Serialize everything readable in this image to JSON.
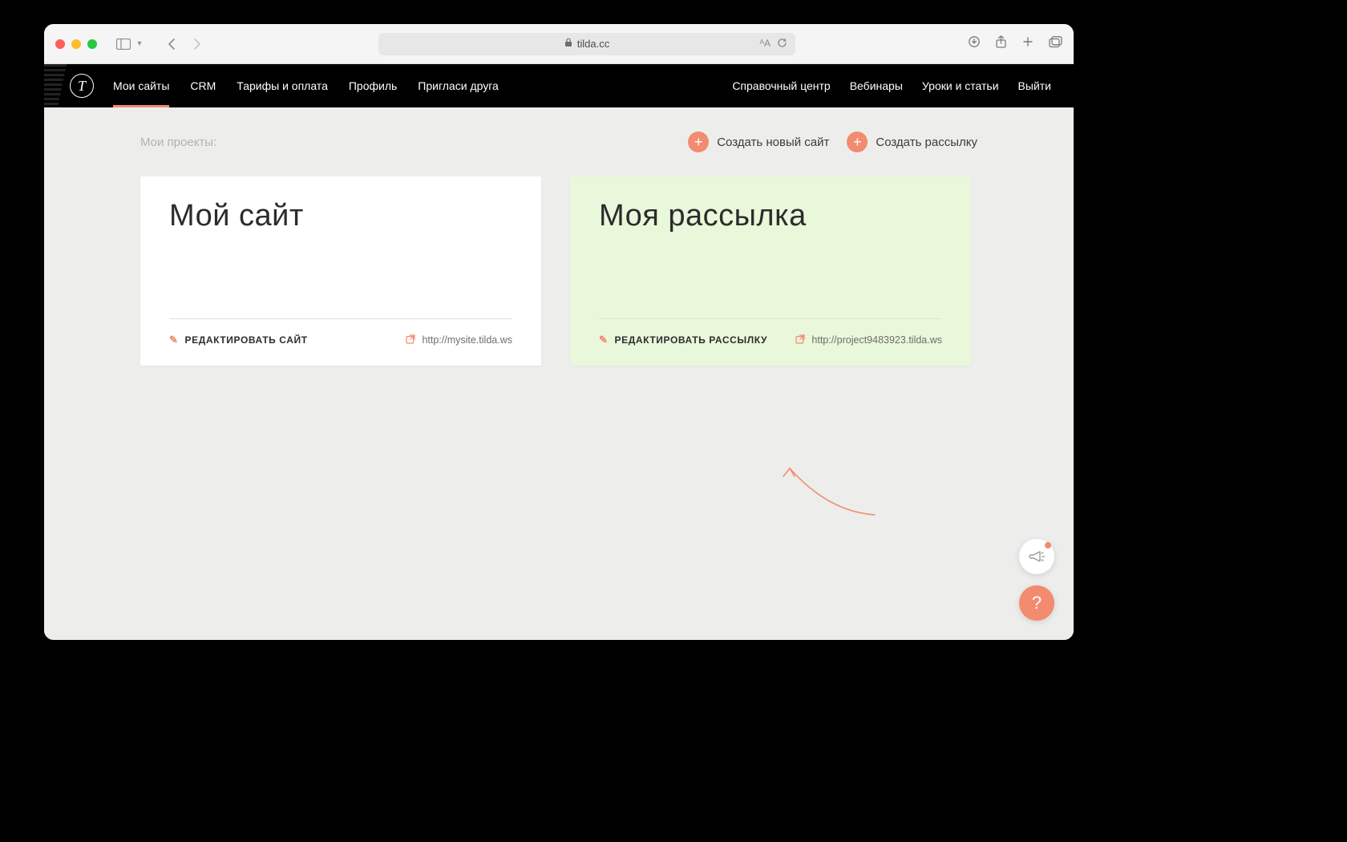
{
  "browser": {
    "url": "tilda.cc"
  },
  "nav": {
    "main": [
      "Мои сайты",
      "CRM",
      "Тарифы и оплата",
      "Профиль",
      "Пригласи друга"
    ],
    "right": [
      "Справочный центр",
      "Вебинары",
      "Уроки и статьи",
      "Выйти"
    ],
    "logo_letter": "T"
  },
  "page": {
    "heading": "Мои проекты:",
    "actions": {
      "new_site": "Создать новый сайт",
      "new_newsletter": "Создать рассылку"
    }
  },
  "cards": [
    {
      "title": "Мой сайт",
      "edit_label": "РЕДАКТИРОВАТЬ САЙТ",
      "url": "http://mysite.tilda.ws"
    },
    {
      "title": "Моя рассылка",
      "edit_label": "РЕДАКТИРОВАТЬ РАССЫЛКУ",
      "url": "http://project9483923.tilda.ws"
    }
  ],
  "fab": {
    "help": "?"
  }
}
